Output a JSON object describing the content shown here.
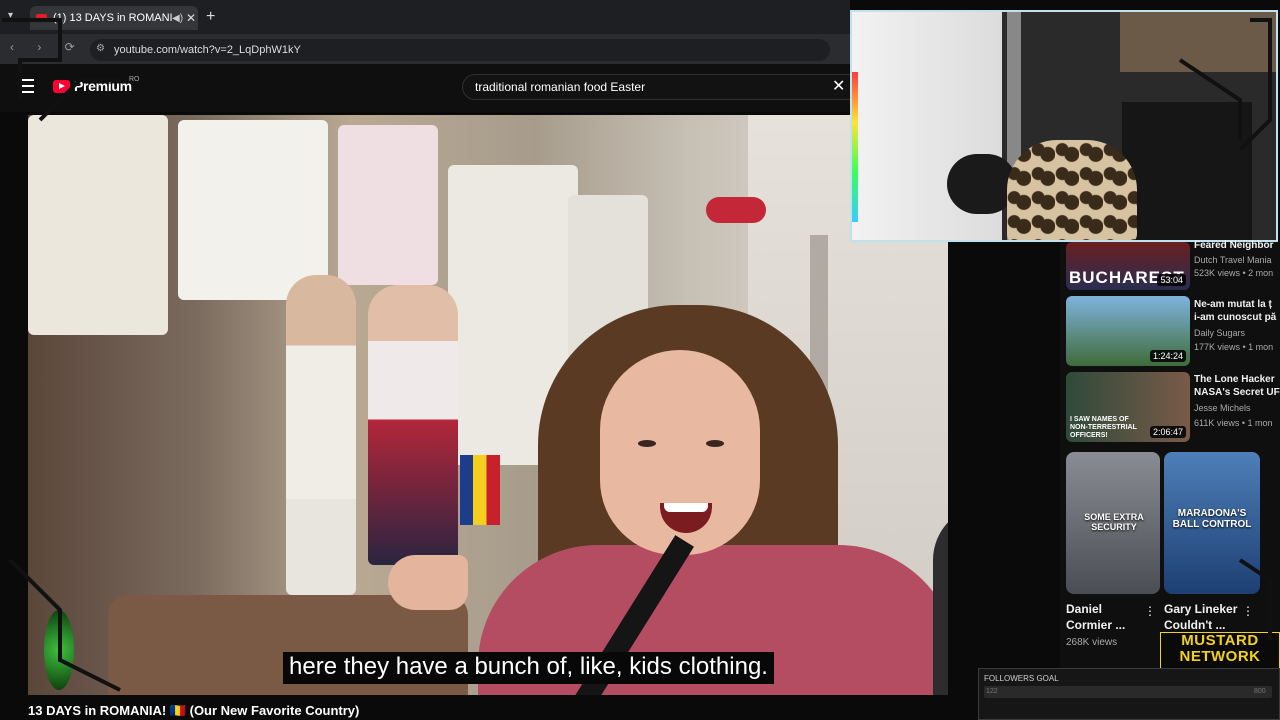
{
  "browser": {
    "tab_title": "(1) 13 DAYS in ROMANIA! ...",
    "url": "youtube.com/watch?v=2_LqDphW1kY"
  },
  "youtube": {
    "brand": "Premium",
    "country_code": "RO",
    "search_value": "traditional romanian food Easter",
    "video_title": "13 DAYS in ROMANIA! 🇷🇴 (Our New Favorite Country)",
    "subtitle": "here they have a bunch of, like, kids clothing."
  },
  "recommendations": [
    {
      "title": "Feared Neighbor",
      "channel": "Dutch Travel Mania",
      "views": "523K views • 2 mon",
      "duration": "53:04",
      "thumb_text": "BUCHAREST"
    },
    {
      "title": "Ne-am mutat la ț",
      "title2": "i-am cunoscut pă",
      "channel": "Daily Sugars",
      "views": "177K views • 1 mon",
      "duration": "1:24:24"
    },
    {
      "title": "The Lone Hacker",
      "title2": "NASA's Secret UF",
      "channel": "Jesse Michels",
      "views": "611K views • 1 mon",
      "duration": "2:06:47",
      "thumb_text": "I SAW NAMES OF NON-TERRESTRIAL OFFICERS!"
    }
  ],
  "shorts": [
    {
      "title": "Daniel",
      "title2": "Cormier ...",
      "views": "268K views",
      "caption": "SOME EXTRA SECURITY"
    },
    {
      "title": "Gary Lineker",
      "title2": "Couldn't ...",
      "caption": "MARADONA'S BALL CONTROL"
    }
  ],
  "overlay": {
    "brand_line1": "MUSTARD",
    "brand_line2": "NETWORK",
    "goal_label": "FOLLOWERS GOAL",
    "goal_current": "122",
    "goal_max": "800"
  },
  "colors": {
    "accent": "#ff0033",
    "overlay_brand": "#f2d21c",
    "cam_border": "#bfe2ee"
  }
}
